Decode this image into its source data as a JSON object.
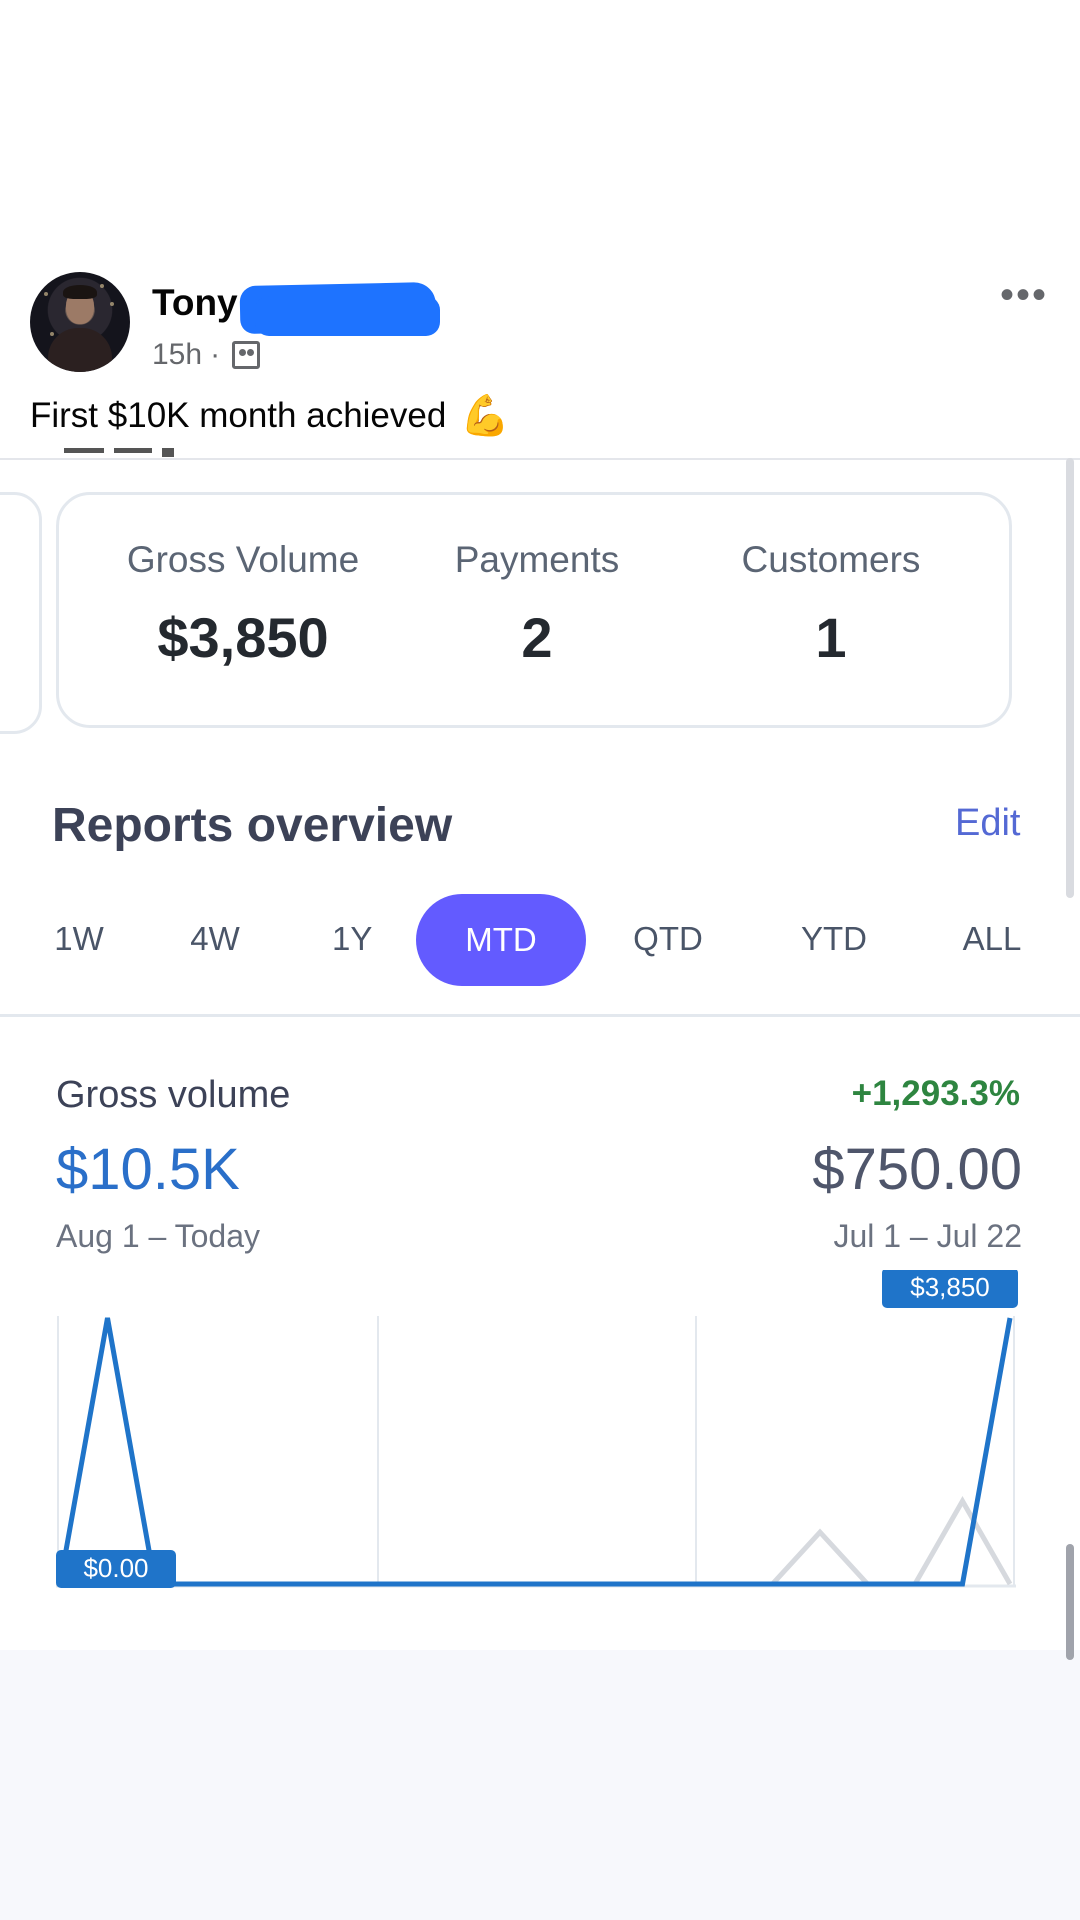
{
  "post": {
    "author": "Tony",
    "time": "15h",
    "separator": "·",
    "text": "First $10K month achieved",
    "emoji": "💪",
    "more": "•••",
    "audience_icon": "friends-icon"
  },
  "stats": [
    {
      "label": "Gross Volume",
      "value": "$3,850"
    },
    {
      "label": "Payments",
      "value": "2"
    },
    {
      "label": "Customers",
      "value": "1"
    }
  ],
  "reports": {
    "title": "Reports overview",
    "edit": "Edit",
    "ranges": [
      "1W",
      "4W",
      "1Y",
      "MTD",
      "QTD",
      "YTD",
      "ALL"
    ],
    "active_range": "MTD"
  },
  "gross_volume": {
    "label": "Gross volume",
    "value": "$10.5K",
    "range": "Aug 1 – Today",
    "change": "+1,293.3%",
    "previous_value": "$750.00",
    "previous_range": "Jul 1 – Jul 22"
  },
  "chart_data": {
    "type": "line",
    "start_label": "$0.00",
    "end_label": "$3,850",
    "series": [
      {
        "values": [
          0,
          3850,
          0,
          0,
          0,
          0,
          0,
          0,
          0,
          0,
          0,
          0,
          0,
          0,
          0,
          0,
          0,
          0,
          0,
          0,
          3850
        ]
      },
      {
        "values": [
          0,
          0,
          0,
          0,
          0,
          0,
          0,
          0,
          0,
          0,
          0,
          0,
          0,
          0,
          0,
          0,
          750,
          0,
          0,
          1200,
          0
        ]
      }
    ],
    "colors": {
      "current": "#1f74c9",
      "previous": "#d6d9de"
    },
    "ylim": [
      0,
      3850
    ]
  }
}
